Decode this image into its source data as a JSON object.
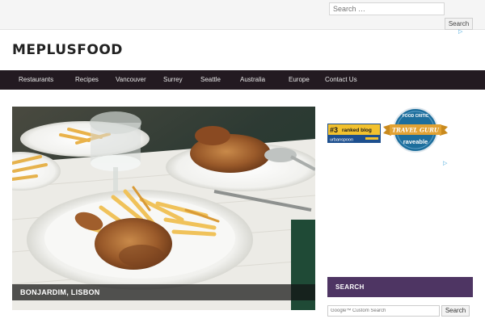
{
  "header": {
    "search_placeholder": "Search …",
    "search_button": "Search",
    "site_title": "MEPLUSFOOD"
  },
  "nav": {
    "items": [
      "Restaurants",
      "Recipes",
      "Vancouver",
      "Surrey",
      "Seattle",
      "Australia",
      "Europe",
      "Contact Us"
    ]
  },
  "hero": {
    "caption": "BONJARDIM, LISBON"
  },
  "badges": {
    "urbanspoon_rank": "#3",
    "urbanspoon_label": "ranked blog",
    "urbanspoon_brand": "urbanspoon",
    "raveable_top": "FOOD CRITIC",
    "raveable_ribbon": "TRAVEL GURU",
    "raveable_brand": "raveable"
  },
  "sidebar": {
    "search_heading": "SEARCH",
    "search_placeholder": "Google™ Custom Search",
    "search_button": "Search"
  },
  "icons": {
    "ad": "adchoices-icon"
  },
  "colors": {
    "nav_bg": "#231a21",
    "sidebar_heading_bg": "#4e3563",
    "urbanspoon_gold": "#f2c12e",
    "raveable_blue": "#1d6e9c",
    "ribbon_orange": "#e2a233"
  }
}
